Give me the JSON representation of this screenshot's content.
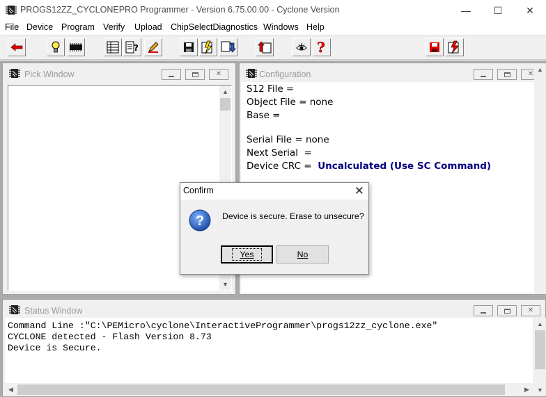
{
  "window": {
    "title": "PROGS12ZZ_CYCLONEPRO Programmer - Version 6.75.00.00 - Cyclone Version",
    "minimize_glyph": "—",
    "maximize_glyph": "☐",
    "close_glyph": "✕"
  },
  "menu": {
    "items": [
      "File",
      "Device",
      "Program",
      "Verify",
      "Upload",
      "ChipSelectDiagnostics",
      "Windows",
      "Help"
    ]
  },
  "toolbar": {
    "buttons": [
      "back-arrow-icon",
      "lightbulb-icon",
      "chip-icon",
      "table-icon",
      "help-doc-icon",
      "pen-icon",
      "save-icon",
      "flash-icon",
      "import-icon",
      "export-icon",
      "eye-icon",
      "question-icon",
      "save-red-icon",
      "flash-red-icon"
    ]
  },
  "pick_window": {
    "title": "Pick Window"
  },
  "configuration": {
    "title": "Configuration",
    "s12_file": "S12 File =",
    "object_file": "Object File = none",
    "base": "Base =",
    "serial_file": "Serial File = none",
    "next_serial": "Next Serial  =",
    "device_crc_label": "Device CRC =",
    "device_crc_value": "Uncalculated (Use SC Command)"
  },
  "status_window": {
    "title": "Status Window",
    "lines": [
      "Command Line :\"C:\\PEMicro\\cyclone\\InteractiveProgrammer\\progs12zz_cyclone.exe\"",
      "CYCLONE detected - Flash Version 8.73",
      "Device is Secure."
    ]
  },
  "dialog": {
    "title": "Confirm",
    "message": "Device is secure. Erase to unsecure?",
    "yes_label": "Yes",
    "no_label": "No",
    "icon": "question-icon"
  },
  "colors": {
    "crc_value": "#000080",
    "mdi_background": "#ababab",
    "question_icon": "#1f5fbf"
  }
}
